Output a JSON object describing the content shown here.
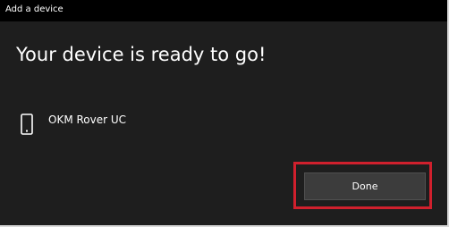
{
  "window": {
    "title": "Add a device"
  },
  "main": {
    "heading": "Your device is ready to go!",
    "device": {
      "icon": "phone-icon",
      "name": "OKM Rover UC"
    },
    "done_label": "Done"
  },
  "colors": {
    "background": "#1e1e1e",
    "title_bar": "#000000",
    "button": "#3c3c3c",
    "highlight": "#d0202d"
  }
}
